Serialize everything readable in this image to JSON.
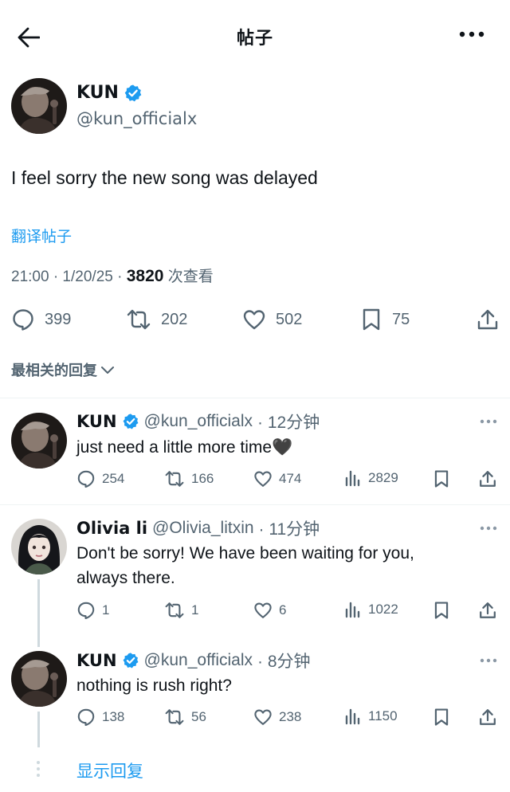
{
  "header": {
    "title": "帖子"
  },
  "main_tweet": {
    "author_name": "KUN",
    "handle": "@kun_officialx",
    "text": "I feel sorry the new song was delayed",
    "translate_link": "翻译帖子",
    "time": "21:00 · 1/20/25 · ",
    "views": "3820",
    "views_label": " 次查看",
    "stats": {
      "replies": "399",
      "reposts": "202",
      "likes": "502",
      "bookmarks": "75"
    }
  },
  "sort_label": "最相关的回复",
  "replies": [
    {
      "name": "KUN",
      "verified": true,
      "handle": "@kun_officialx",
      "time": "· 12分钟",
      "text": "just need a little more time🖤",
      "replies": "254",
      "reposts": "166",
      "likes": "474",
      "views": "2829"
    },
    {
      "name": "Olivia li",
      "verified": false,
      "handle": "@Olivia_litxin",
      "time": "· 11分钟",
      "text_line1": "Don't be sorry! We have been waiting for you,",
      "text_line2": "always there.",
      "replies": "1",
      "reposts": "1",
      "likes": "6",
      "views": "1022"
    },
    {
      "name": "KUN",
      "verified": true,
      "handle": "@kun_officialx",
      "time": "· 8分钟",
      "text": "nothing is rush right?",
      "replies": "138",
      "reposts": "56",
      "likes": "238",
      "views": "1150"
    }
  ],
  "show_replies": "显示回复",
  "colors": {
    "accent": "#1d9bf0",
    "secondary_text": "#536471",
    "text": "#0f1419"
  }
}
